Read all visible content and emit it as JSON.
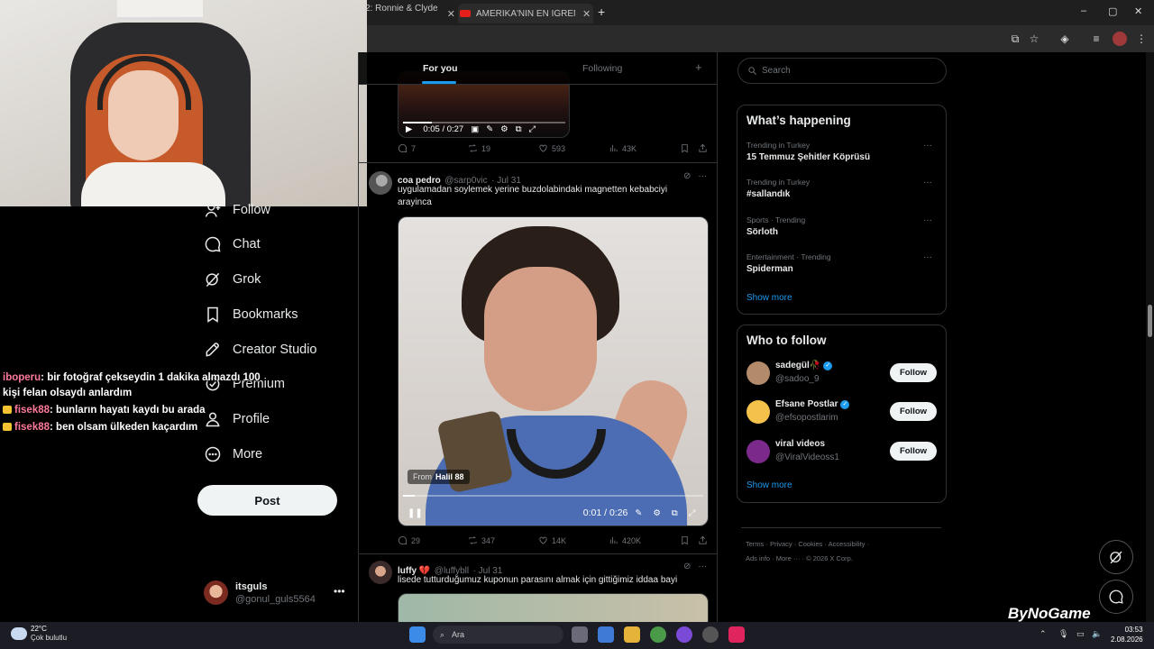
{
  "browser": {
    "tabs": [
      {
        "label": "2: Ronnie & Clyde |"
      },
      {
        "label": "AMERİKA'NIN EN İĞRENÇ PRO"
      }
    ],
    "new_tab": "+",
    "window_controls": [
      "–",
      "▢",
      "✕"
    ]
  },
  "nav": {
    "items": [
      {
        "label": "Follow",
        "icon": "follow-icon"
      },
      {
        "label": "Chat",
        "icon": "chat-icon"
      },
      {
        "label": "Grok",
        "icon": "grok-icon"
      },
      {
        "label": "Bookmarks",
        "icon": "bookmark-icon"
      },
      {
        "label": "Creator Studio",
        "icon": "rocket-icon"
      },
      {
        "label": "Premium",
        "icon": "premium-icon"
      },
      {
        "label": "Profile",
        "icon": "profile-icon"
      },
      {
        "label": "More",
        "icon": "more-icon"
      }
    ],
    "post_label": "Post",
    "account": {
      "name": "itsguls",
      "handle": "@gonul_guls5564",
      "more": "•••"
    }
  },
  "chat_overlay": [
    {
      "user": "iboperu",
      "text": ": bir fotoğraf çekseydin 1 dakika almazdı 100",
      "badge": false
    },
    {
      "user": "",
      "text": "kişi felan olsaydı anlardım",
      "badge": false
    },
    {
      "user": "fisek88",
      "text": ": bunların hayatı kaydı bu arada",
      "badge": true
    },
    {
      "user": "fisek88",
      "text": ": ben olsam ülkeden kaçardım",
      "badge": true
    }
  ],
  "timeline": {
    "tabs": {
      "for_you": "For you",
      "following": "Following",
      "plus": "+"
    },
    "tweet1": {
      "video_time": "0:05 / 0:27",
      "progress": 0.18,
      "stats": {
        "replies": "7",
        "reposts": "19",
        "likes": "593",
        "views": "43K"
      }
    },
    "tweet2": {
      "name": "coa pedro",
      "handle": "@sarp0vic",
      "date": "· Jul 31",
      "text": "uygulamadan soylemek yerine buzdolabindaki magnetten kebabciyi arayinca",
      "from_label": "From",
      "from_user": "Halil 88",
      "video_time": "0:01 / 0:26",
      "progress": 0.04,
      "stats": {
        "replies": "29",
        "reposts": "347",
        "likes": "14K",
        "views": "420K"
      }
    },
    "tweet3": {
      "name": "luffy 💔",
      "handle": "@luffybll",
      "date": "· Jul 31",
      "text": "lisede tutturduğumuz kuponun parasını almak için gittiğimiz iddaa bayi"
    }
  },
  "sidebar": {
    "search_placeholder": "Search",
    "trends_title": "What’s happening",
    "trends": [
      {
        "context": "Trending in Turkey",
        "name": "15 Temmuz Şehitler Köprüsü"
      },
      {
        "context": "Trending in Turkey",
        "name": "#sallandık"
      },
      {
        "context": "Sports · Trending",
        "name": "Sörloth"
      },
      {
        "context": "Entertainment · Trending",
        "name": "Spiderman"
      }
    ],
    "show_more": "Show more",
    "who_title": "Who to follow",
    "who": [
      {
        "name": "sadegül🥀",
        "handle": "@sadoo_9",
        "verified": true,
        "avatar_color": "#b38a6a"
      },
      {
        "name": "Efsane Postlar",
        "handle": "@efsopostlarim",
        "verified": true,
        "avatar_color": "#f4c24a"
      },
      {
        "name": "viral videos",
        "handle": "@ViralVideoss1",
        "verified": false,
        "avatar_color": "#7b2a8c"
      }
    ],
    "follow_label": "Follow",
    "footer_row1": "Terms  ·  Privacy  ·  Cookies  ·  Accessibility  ·",
    "footer_row2": "Ads info  ·  More ···  ·  © 2026 X Corp."
  },
  "watermark": "ByNoGame",
  "taskbar": {
    "weather_temp": "22°C",
    "weather_desc": "Çok bulutlu",
    "search_placeholder": "Ara",
    "time": "03:53",
    "date": "2.08.2026"
  }
}
